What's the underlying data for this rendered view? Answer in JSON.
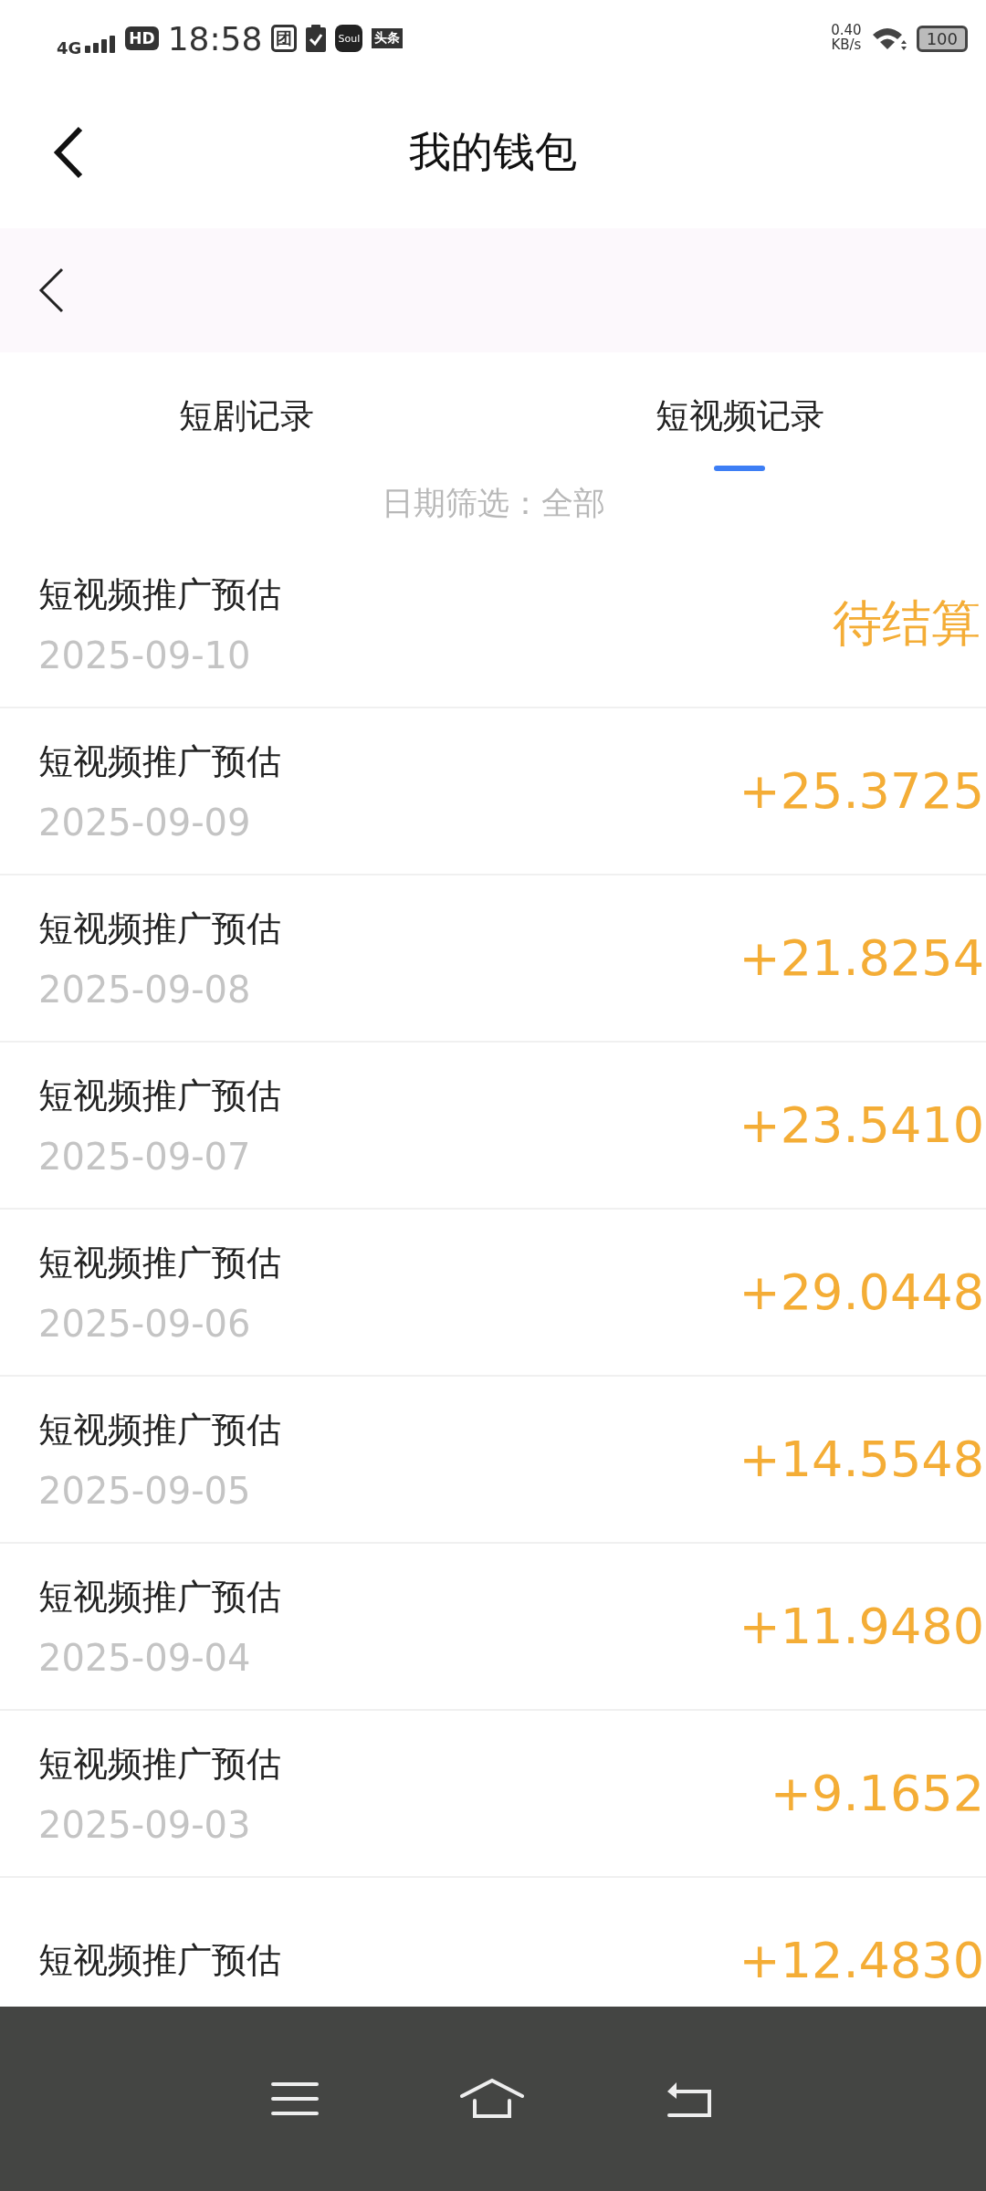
{
  "status_bar": {
    "network": "4G",
    "hd": "HD",
    "time": "18:58",
    "app_icons": [
      "团",
      "Soul",
      "头条"
    ],
    "speed": "0.40",
    "speed_unit": "KB/s",
    "battery": "100"
  },
  "header": {
    "title": "我的钱包"
  },
  "tabs": [
    {
      "label": "短剧记录",
      "selected": false
    },
    {
      "label": "短视频记录",
      "selected": true
    }
  ],
  "filter": "日期筛选：全部",
  "records": [
    {
      "title": "短视频推广预估",
      "date": "2025-09-10",
      "amount": "待结算"
    },
    {
      "title": "短视频推广预估",
      "date": "2025-09-09",
      "amount": "+25.3725"
    },
    {
      "title": "短视频推广预估",
      "date": "2025-09-08",
      "amount": "+21.8254"
    },
    {
      "title": "短视频推广预估",
      "date": "2025-09-07",
      "amount": "+23.5410"
    },
    {
      "title": "短视频推广预估",
      "date": "2025-09-06",
      "amount": "+29.0448"
    },
    {
      "title": "短视频推广预估",
      "date": "2025-09-05",
      "amount": "+14.5548"
    },
    {
      "title": "短视频推广预估",
      "date": "2025-09-04",
      "amount": "+11.9480"
    },
    {
      "title": "短视频推广预估",
      "date": "2025-09-03",
      "amount": "+9.1652"
    },
    {
      "title": "短视频推广预估",
      "amount": "+12.4830"
    }
  ]
}
